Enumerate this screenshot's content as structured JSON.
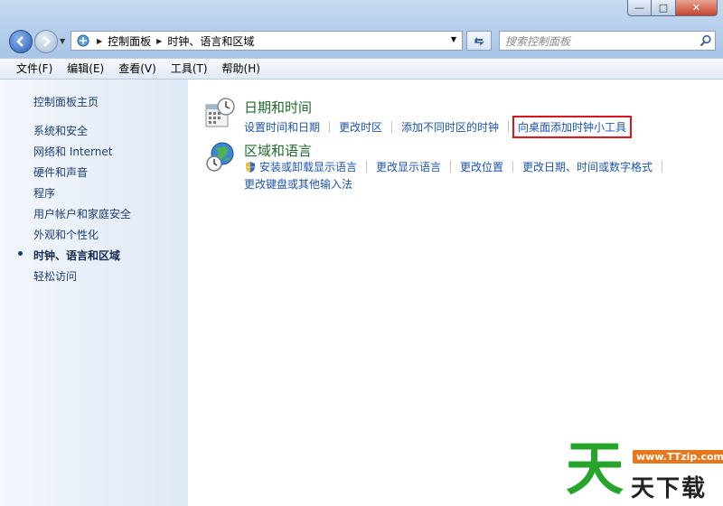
{
  "window": {
    "caption": {
      "minimize": "—",
      "maximize": "□",
      "close": "✕"
    }
  },
  "address": {
    "crumbs": [
      "控制面板",
      "时钟、语言和区域"
    ],
    "search_placeholder": "搜索控制面板"
  },
  "menu": [
    "文件(F)",
    "编辑(E)",
    "查看(V)",
    "工具(T)",
    "帮助(H)"
  ],
  "sidebar": {
    "items": [
      {
        "label": "控制面板主页"
      },
      {
        "label": "系统和安全"
      },
      {
        "label": "网络和 Internet"
      },
      {
        "label": "硬件和声音"
      },
      {
        "label": "程序"
      },
      {
        "label": "用户帐户和家庭安全"
      },
      {
        "label": "外观和个性化"
      },
      {
        "label": "时钟、语言和区域",
        "active": true
      },
      {
        "label": "轻松访问"
      }
    ]
  },
  "categories": [
    {
      "title": "日期和时间",
      "icon": "calendar-clock-icon",
      "links": [
        "设置时间和日期",
        "更改时区",
        "添加不同时区的时钟",
        "向桌面添加时钟小工具"
      ]
    },
    {
      "title": "区域和语言",
      "icon": "globe-clock-icon",
      "links": [
        "安装或卸载显示语言",
        "更改显示语言",
        "更改位置",
        "更改日期、时间或数字格式"
      ],
      "links2": [
        "更改键盘或其他输入法"
      ]
    }
  ],
  "watermark": {
    "char": "天",
    "url": "www.TTzip.com",
    "name": "天下载"
  },
  "colors": {
    "link": "#1c55b0",
    "category_title": "#1f6b2b",
    "highlight_box": "#d8161b",
    "sidebar_text": "#1e3f77"
  }
}
